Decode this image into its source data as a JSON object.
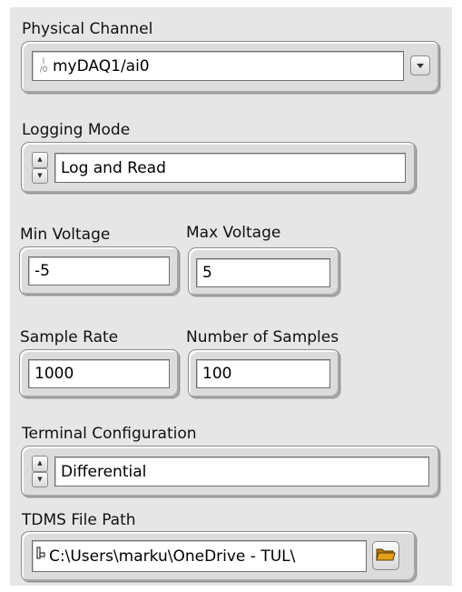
{
  "physical_channel": {
    "label": "Physical Channel",
    "value": "myDAQ1/ai0",
    "io_icon": "I/O"
  },
  "logging_mode": {
    "label": "Logging Mode",
    "value": "Log and Read"
  },
  "min_voltage": {
    "label": "Min Voltage",
    "value": "-5"
  },
  "max_voltage": {
    "label": "Max Voltage",
    "value": "5"
  },
  "sample_rate": {
    "label": "Sample Rate",
    "value": "1000"
  },
  "number_of_samples": {
    "label": "Number of Samples",
    "value": "100"
  },
  "terminal_configuration": {
    "label": "Terminal Configuration",
    "value": "Differential"
  },
  "tdms_file_path": {
    "label": "TDMS File Path",
    "value": "C:\\Users\\marku\\OneDrive - TUL\\"
  },
  "icons": {
    "dropdown": "chevron-down-icon",
    "spinner_up": "arrow-up-icon",
    "spinner_down": "arrow-down-icon",
    "browse": "folder-icon",
    "path": "path-icon"
  },
  "colors": {
    "panel_bg": "#e6e6e6",
    "field_bg": "#ffffff",
    "folder": "#e3a21a"
  }
}
